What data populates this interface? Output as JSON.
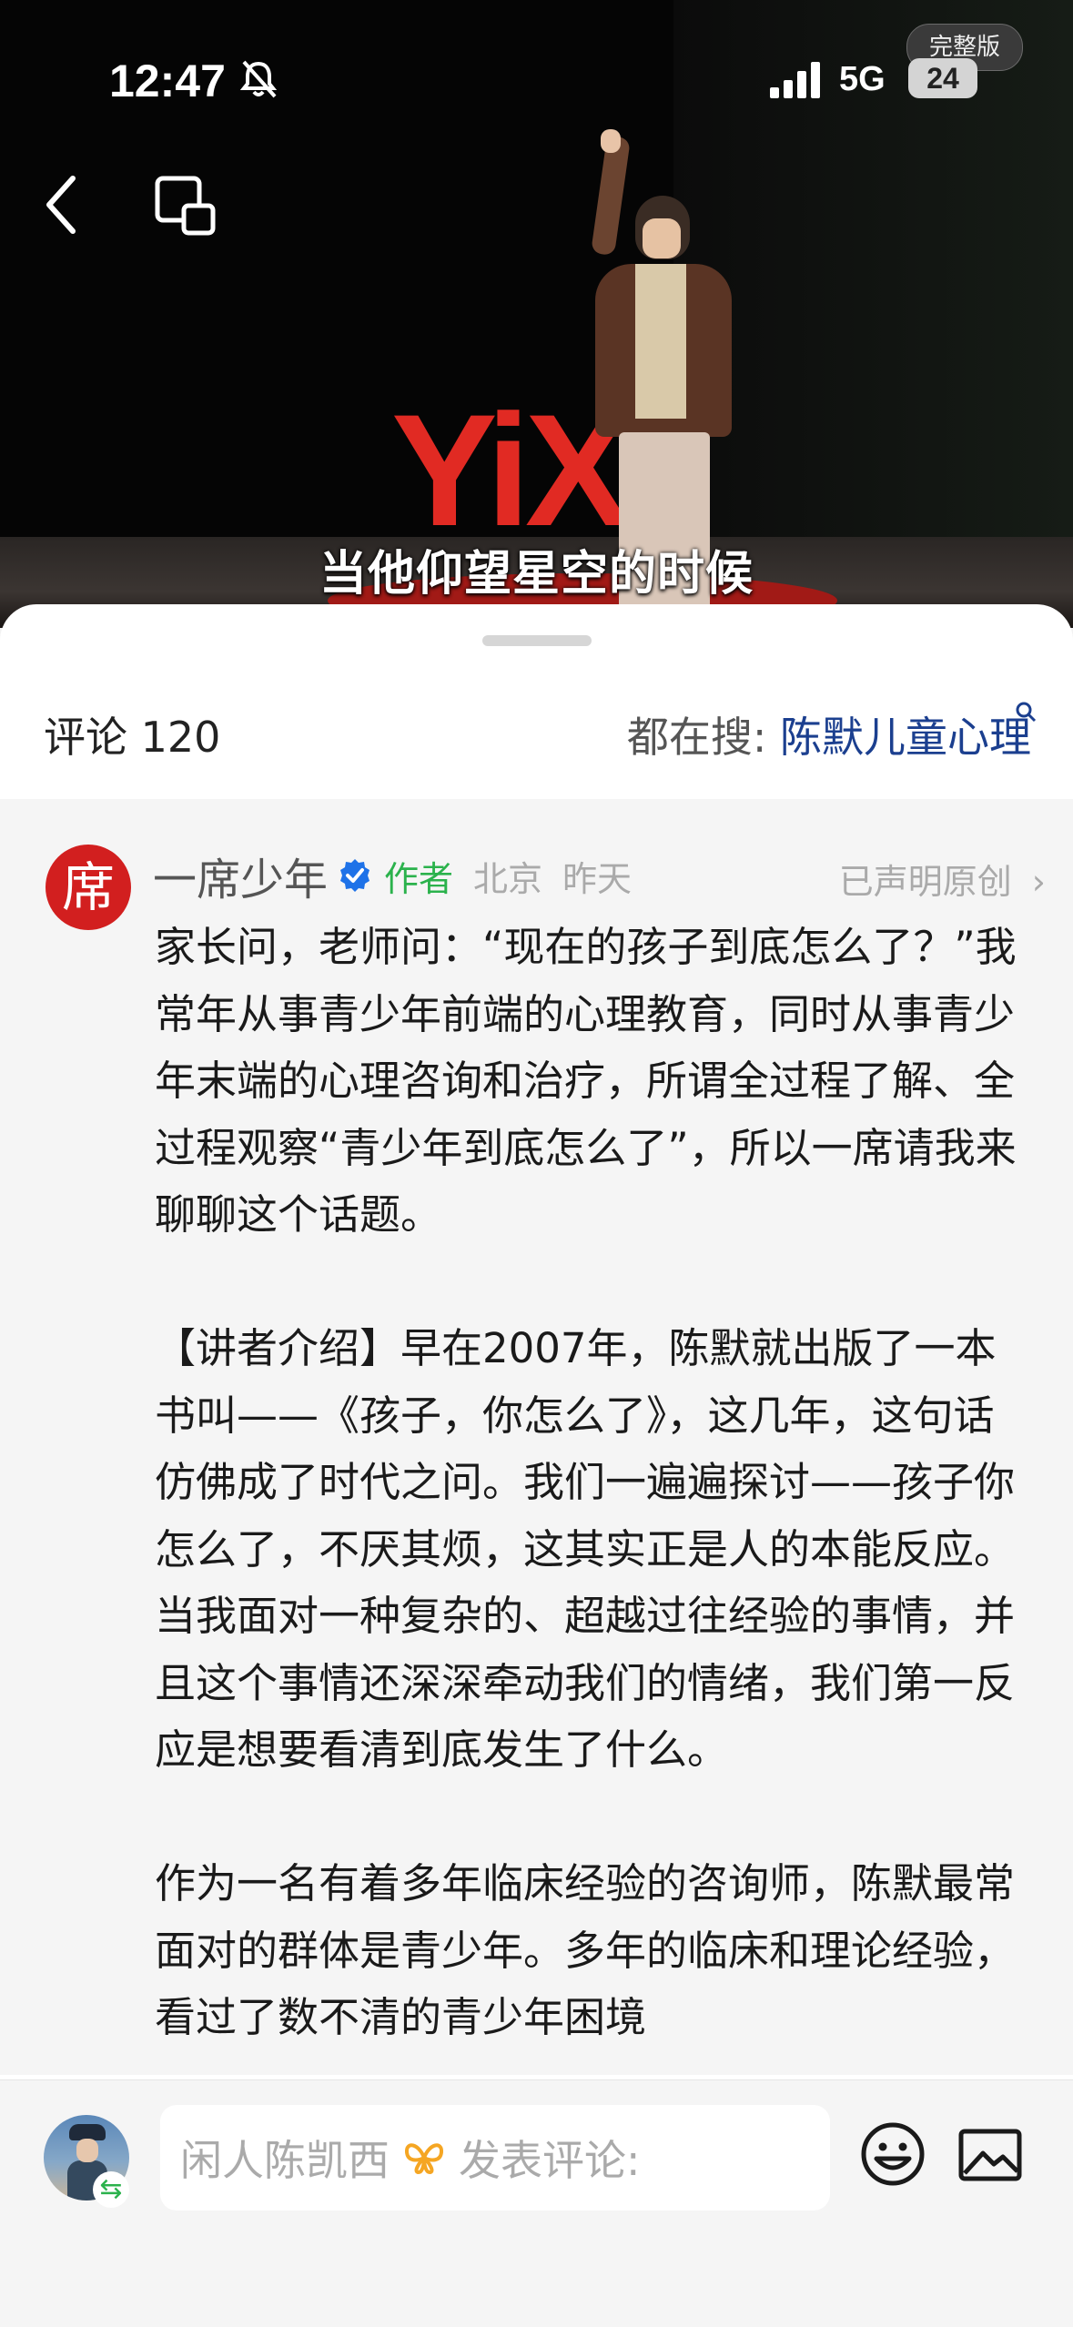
{
  "status_bar": {
    "time": "12:47",
    "network": "5G",
    "battery": "24",
    "full_version_badge": "完整版"
  },
  "video": {
    "subtitle": "当他仰望星空的时候",
    "stage_logo": "YiX"
  },
  "comments_header": {
    "count_label": "评论 120",
    "hot_search_prefix": "都在搜:",
    "hot_search_keyword": "陈默儿童心理"
  },
  "post": {
    "avatar_char": "席",
    "author": "一席少年",
    "author_tag": "作者",
    "location": "北京",
    "time": "昨天",
    "original_label": "已声明原创",
    "paragraphs": [
      "家长问，老师问：“现在的孩子到底怎么了？”我常年从事青少年前端的心理教育，同时从事青少年末端的心理咨询和治疗，所谓全过程了解、全过程观察“青少年到底怎么了”，所以一席请我来聊聊这个话题。",
      "【讲者介绍】早在2007年，陈默就出版了一本书叫——《孩子，你怎么了》，这几年，这句话仿佛成了时代之问。我们一遍遍探讨——孩子你怎么了，不厌其烦，这其实正是人的本能反应。当我面对一种复杂的、超越过往经验的事情，并且这个事情还深深牵动我们的情绪，我们第一反应是想要看清到底发生了什么。",
      "作为一名有着多年临床经验的咨询师，陈默最常面对的群体是青少年。多年的临床和理论经验，看过了数不清的青少年困境"
    ]
  },
  "input_bar": {
    "user_name": "闲人陈凯西",
    "placeholder": "发表评论:"
  },
  "colors": {
    "accent_link": "#1b3f8f",
    "author_green": "#2bb24c",
    "logo_red": "#e12a23"
  }
}
